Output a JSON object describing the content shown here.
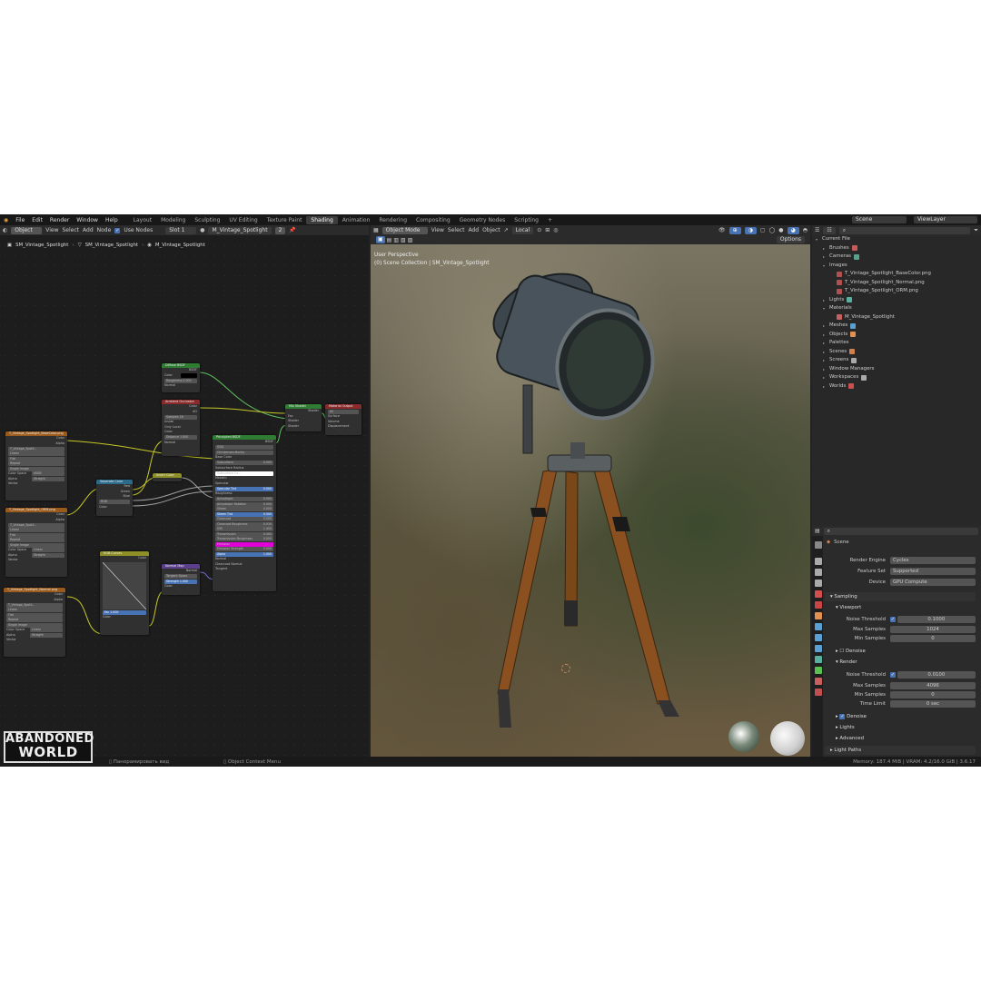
{
  "topbar": {
    "menu": [
      "File",
      "Edit",
      "Render",
      "Window",
      "Help"
    ],
    "workspaces": [
      "Layout",
      "Modeling",
      "Sculpting",
      "UV Editing",
      "Texture Paint",
      "Shading",
      "Animation",
      "Rendering",
      "Compositing",
      "Geometry Nodes",
      "Scripting"
    ],
    "add_tab": "+",
    "scene": "Scene",
    "view_layer": "ViewLayer"
  },
  "node_editor": {
    "mode": "Object",
    "menu": [
      "View",
      "Select",
      "Add",
      "Node"
    ],
    "use_nodes": "Use Nodes",
    "slot": "Slot 1",
    "material": "M_Vintage_Spotlight",
    "users": "2",
    "breadcrumb": [
      "SM_Vintage_Spotlight",
      "SM_Vintage_Spotlight",
      "M_Vintage_Spotlight"
    ],
    "nodes": {
      "diffuse": {
        "title": "Diffuse BSDF",
        "out": "BSDF",
        "color": "Color",
        "roughness": "Roughness",
        "roughness_val": "0.000",
        "normal": "Normal"
      },
      "ao": {
        "title": "Ambient Occlusion",
        "out_color": "Color",
        "out_ao": "AO",
        "samples": "Samples",
        "samples_val": "16",
        "inside": "Inside",
        "only_local": "Only Local",
        "color": "Color",
        "distance": "Distance",
        "distance_val": "1.000",
        "normal": "Normal"
      },
      "mix": {
        "title": "Mix Shader",
        "out": "Shader",
        "fac": "Fac",
        "shader1": "Shader",
        "shader2": "Shader"
      },
      "output": {
        "title": "Material Output",
        "target": "All",
        "surface": "Surface",
        "volume": "Volume",
        "displacement": "Displacement"
      },
      "principled": {
        "title": "Principled BSDF",
        "out": "BSDF",
        "dist": "GGX",
        "sss_method": "Christensen-Burley",
        "rows": [
          {
            "label": "Base Color",
            "val": ""
          },
          {
            "label": "Subsurface",
            "val": "0.000"
          },
          {
            "label": "Subsurface Radius",
            "val": ""
          },
          {
            "label": "Subsurface Co...",
            "val": ""
          },
          {
            "label": "Metallic",
            "val": ""
          },
          {
            "label": "Specular",
            "val": ""
          },
          {
            "label": "Specular Tint",
            "val": "0.000"
          },
          {
            "label": "Roughness",
            "val": ""
          },
          {
            "label": "Anisotropic",
            "val": "0.000"
          },
          {
            "label": "Anisotropic Rotation",
            "val": "0.000"
          },
          {
            "label": "Sheen",
            "val": "0.000"
          },
          {
            "label": "Sheen Tint",
            "val": "0.500"
          },
          {
            "label": "Clearcoat",
            "val": "0.000"
          },
          {
            "label": "Clearcoat Roughness",
            "val": "0.030"
          },
          {
            "label": "IOR",
            "val": "1.450"
          },
          {
            "label": "Transmission",
            "val": "0.000"
          },
          {
            "label": "Transmission Roughness",
            "val": "0.000"
          },
          {
            "label": "Emission",
            "val": ""
          },
          {
            "label": "Emission Strength",
            "val": "0.000"
          },
          {
            "label": "Alpha",
            "val": "1.000"
          },
          {
            "label": "Normal",
            "val": ""
          },
          {
            "label": "Clearcoat Normal",
            "val": ""
          },
          {
            "label": "Tangent",
            "val": ""
          }
        ]
      },
      "basecolor_img": {
        "title": "T_Vintage_Spotlight_BaseColor.png",
        "out_color": "Color",
        "out_alpha": "Alpha",
        "file": "T_Vintage_Spotli...",
        "interp": "Linear",
        "proj": "Flat",
        "ext": "Repeat",
        "src": "Single Image",
        "cs_label": "Color Space",
        "cs": "sRGB",
        "alpha_label": "Alpha",
        "alpha": "Straight",
        "vector": "Vector"
      },
      "orm_img": {
        "title": "T_Vintage_Spotlight_ORM.png",
        "out_color": "Color",
        "out_alpha": "Alpha",
        "file": "T_Vintage_Spotli...",
        "interp": "Linear",
        "proj": "Flat",
        "ext": "Repeat",
        "src": "Single Image",
        "cs_label": "Color Space",
        "cs": "Linear",
        "alpha_label": "Alpha",
        "alpha": "Straight",
        "vector": "Vector"
      },
      "normal_img": {
        "title": "T_Vintage_Spotlight_Normal.png",
        "out_color": "Color",
        "out_alpha": "Alpha",
        "file": "T_Vintage_Spotli...",
        "interp": "Linear",
        "proj": "Flat",
        "ext": "Repeat",
        "src": "Single Image",
        "cs_label": "Color Space",
        "cs": "Linear",
        "alpha_label": "Alpha",
        "alpha": "Straight",
        "vector": "Vector"
      },
      "separate": {
        "title": "Separate Color",
        "red": "Red",
        "green": "Green",
        "blue": "Blue",
        "mode": "RGB",
        "color": "Color"
      },
      "invert": {
        "title": "Invert Color"
      },
      "rgb_curves": {
        "title": "RGB Curves",
        "out": "Color",
        "fac": "Fac",
        "fac_val": "1.000",
        "color": "Color"
      },
      "normal_map": {
        "title": "Normal Map",
        "out": "Normal",
        "space": "Tangent Space",
        "strength": "Strength",
        "strength_val": "1.000",
        "color": "Color"
      }
    }
  },
  "viewport": {
    "mode": "Object Mode",
    "menu": [
      "View",
      "Select",
      "Add",
      "Object"
    ],
    "orientation": "Local",
    "options": "Options",
    "overlay_title": "User Perspective",
    "overlay_sub": "(0) Scene Collection | SM_Vintage_Spotlight"
  },
  "outliner": {
    "root": "Current File",
    "items": [
      {
        "label": "Brushes",
        "indent": 1,
        "arrow": "▸",
        "color": "#c85a5a"
      },
      {
        "label": "Cameras",
        "indent": 1,
        "arrow": "▸",
        "color": "#5aa08c"
      },
      {
        "label": "Images",
        "indent": 1,
        "arrow": "▾",
        "color": ""
      },
      {
        "label": "T_Vintage_Spotlight_BaseColor.png",
        "indent": 2,
        "arrow": "",
        "color": "#b05050"
      },
      {
        "label": "T_Vintage_Spotlight_Normal.png",
        "indent": 2,
        "arrow": "",
        "color": "#b05050"
      },
      {
        "label": "T_Vintage_Spotlight_ORM.png",
        "indent": 2,
        "arrow": "",
        "color": "#b05050"
      },
      {
        "label": "Lights",
        "indent": 1,
        "arrow": "▸",
        "color": "#5ab0a0"
      },
      {
        "label": "Materials",
        "indent": 1,
        "arrow": "▾",
        "color": ""
      },
      {
        "label": "M_Vintage_Spotlight",
        "indent": 2,
        "arrow": "",
        "color": "#c86060"
      },
      {
        "label": "Meshes",
        "indent": 1,
        "arrow": "▸",
        "color": "#5aa0d0"
      },
      {
        "label": "Objects",
        "indent": 1,
        "arrow": "▸",
        "color": "#e09050"
      },
      {
        "label": "Palettes",
        "indent": 1,
        "arrow": "▸",
        "color": ""
      },
      {
        "label": "Scenes",
        "indent": 1,
        "arrow": "▸",
        "color": "#d08050"
      },
      {
        "label": "Screens",
        "indent": 1,
        "arrow": "▸",
        "color": "#aaaaaa"
      },
      {
        "label": "Window Managers",
        "indent": 1,
        "arrow": "▸",
        "color": ""
      },
      {
        "label": "Workspaces",
        "indent": 1,
        "arrow": "▸",
        "color": "#aaaaaa"
      },
      {
        "label": "Worlds",
        "indent": 1,
        "arrow": "▸",
        "color": "#c85050"
      }
    ]
  },
  "properties": {
    "context": "Scene",
    "render_engine_label": "Render Engine",
    "render_engine": "Cycles",
    "feature_set_label": "Feature Set",
    "feature_set": "Supported",
    "device_label": "Device",
    "device": "GPU Compute",
    "sampling": "Sampling",
    "viewport": "Viewport",
    "noise_threshold_label": "Noise Threshold",
    "vp_noise": "0.1000",
    "max_samples_label": "Max Samples",
    "vp_max": "1024",
    "min_samples_label": "Min Samples",
    "vp_min": "0",
    "denoise": "Denoise",
    "render": "Render",
    "r_noise": "0.0100",
    "r_max": "4096",
    "r_min": "0",
    "time_limit_label": "Time Limit",
    "time_limit": "0 sec",
    "denoise2": "Denoise",
    "lights": "Lights",
    "advanced": "Advanced",
    "light_paths": "Light Paths"
  },
  "statusbar": {
    "left": "Панорамировать вид",
    "mid": "Object Context Menu",
    "right": "Memory: 187.4 MiB | VRAM: 4.2/16.0 GiB | 3.6.17"
  },
  "logo": {
    "line1": "ABANDONED",
    "line2": "WORLD"
  },
  "colors": {
    "accent": "#4772b3",
    "shader_green": "#2e7d32",
    "texture_orange": "#9a5a1c",
    "vector_purple": "#5b3f8c",
    "color_yellow": "#8f8f28",
    "converter_blue": "#2a6a8a",
    "output_red": "#8a2a2a"
  }
}
